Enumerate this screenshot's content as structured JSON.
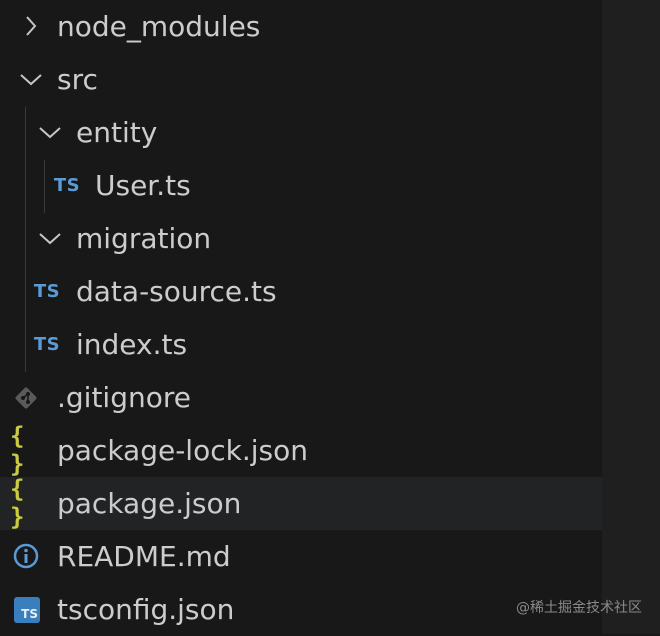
{
  "tree": [
    {
      "label": "node_modules",
      "kind": "folder",
      "state": "collapsed",
      "icon": "chevron-right-icon"
    },
    {
      "label": "src",
      "kind": "folder",
      "state": "expanded",
      "icon": "chevron-down-icon"
    },
    {
      "label": "entity",
      "kind": "folder",
      "state": "expanded",
      "icon": "chevron-down-icon"
    },
    {
      "label": "User.ts",
      "kind": "file",
      "icon": "typescript-file-icon",
      "badge": "TS"
    },
    {
      "label": "migration",
      "kind": "folder",
      "state": "expanded",
      "icon": "chevron-down-icon"
    },
    {
      "label": "data-source.ts",
      "kind": "file",
      "icon": "typescript-file-icon",
      "badge": "TS"
    },
    {
      "label": "index.ts",
      "kind": "file",
      "icon": "typescript-file-icon",
      "badge": "TS"
    },
    {
      "label": ".gitignore",
      "kind": "file",
      "icon": "git-icon"
    },
    {
      "label": "package-lock.json",
      "kind": "file",
      "icon": "json-icon",
      "badge": "{ }"
    },
    {
      "label": "package.json",
      "kind": "file",
      "icon": "json-icon",
      "badge": "{ }",
      "hovered": true
    },
    {
      "label": "README.md",
      "kind": "file",
      "icon": "info-icon"
    },
    {
      "label": "tsconfig.json",
      "kind": "file",
      "icon": "tsconfig-icon",
      "badge": "TS"
    }
  ],
  "watermark": "@稀土掘金技术社区",
  "colors": {
    "background": "#181818",
    "text": "#cccccc",
    "ts_badge": "#5b9bd5",
    "json_badge": "#cbcb41",
    "hover_row": "#222324"
  }
}
